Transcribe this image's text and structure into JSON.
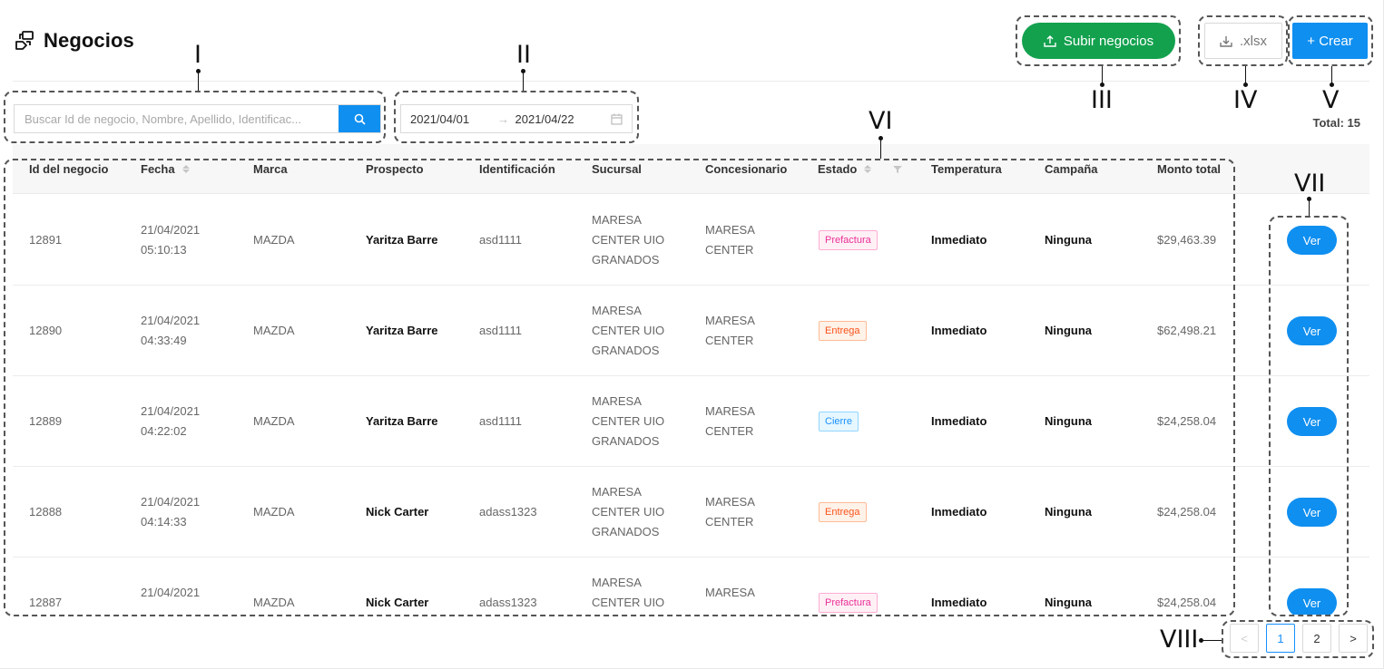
{
  "page": {
    "title": "Negocios",
    "icon": "handshake-icon"
  },
  "toolbar": {
    "upload_label": "Subir negocios",
    "xlsx_label": ".xlsx",
    "create_label": "+ Crear",
    "total_label": "Total: 15"
  },
  "search": {
    "placeholder": "Buscar Id de negocio, Nombre, Apellido, Identificac..."
  },
  "daterange": {
    "start": "2021/04/01",
    "end": "2021/04/22",
    "separator": "→"
  },
  "table": {
    "columns": [
      "Id del negocio",
      "Fecha",
      "Marca",
      "Prospecto",
      "Identificación",
      "Sucursal",
      "Concesionario",
      "Estado",
      "Temperatura",
      "Campaña",
      "Monto total"
    ],
    "action_label": "Ver",
    "rows": [
      {
        "id": "12891",
        "fecha1": "21/04/2021",
        "fecha2": "05:10:13",
        "marca": "MAZDA",
        "prospecto": "Yaritza Barre",
        "identificacion": "asd1111",
        "suc1": "MARESA",
        "suc2": "CENTER UIO",
        "suc3": "GRANADOS",
        "con1": "MARESA",
        "con2": "CENTER",
        "estado": "Prefactura",
        "estado_color": "pink",
        "temperatura": "Inmediato",
        "campana": "Ninguna",
        "monto": "$29,463.39"
      },
      {
        "id": "12890",
        "fecha1": "21/04/2021",
        "fecha2": "04:33:49",
        "marca": "MAZDA",
        "prospecto": "Yaritza Barre",
        "identificacion": "asd1111",
        "suc1": "MARESA",
        "suc2": "CENTER UIO",
        "suc3": "GRANADOS",
        "con1": "MARESA",
        "con2": "CENTER",
        "estado": "Entrega",
        "estado_color": "orange",
        "temperatura": "Inmediato",
        "campana": "Ninguna",
        "monto": "$62,498.21"
      },
      {
        "id": "12889",
        "fecha1": "21/04/2021",
        "fecha2": "04:22:02",
        "marca": "MAZDA",
        "prospecto": "Yaritza Barre",
        "identificacion": "asd1111",
        "suc1": "MARESA",
        "suc2": "CENTER UIO",
        "suc3": "GRANADOS",
        "con1": "MARESA",
        "con2": "CENTER",
        "estado": "Cierre",
        "estado_color": "blue",
        "temperatura": "Inmediato",
        "campana": "Ninguna",
        "monto": "$24,258.04"
      },
      {
        "id": "12888",
        "fecha1": "21/04/2021",
        "fecha2": "04:14:33",
        "marca": "MAZDA",
        "prospecto": "Nick Carter",
        "identificacion": "adass1323",
        "suc1": "MARESA",
        "suc2": "CENTER UIO",
        "suc3": "GRANADOS",
        "con1": "MARESA",
        "con2": "CENTER",
        "estado": "Entrega",
        "estado_color": "orange",
        "temperatura": "Inmediato",
        "campana": "Ninguna",
        "monto": "$24,258.04"
      },
      {
        "id": "12887",
        "fecha1": "21/04/2021",
        "fecha2": "",
        "marca": "MAZDA",
        "prospecto": "Nick Carter",
        "identificacion": "adass1323",
        "suc1": "MARESA",
        "suc2": "CENTER UIO",
        "suc3": "",
        "con1": "MARESA",
        "con2": "",
        "estado": "Prefactura",
        "estado_color": "pink",
        "temperatura": "Inmediato",
        "campana": "Ninguna",
        "monto": "$24,258.04"
      }
    ]
  },
  "pagination": {
    "prev": "<",
    "pages": [
      "1",
      "2"
    ],
    "active": "1",
    "next": ">"
  },
  "annotations": [
    "I",
    "II",
    "III",
    "IV",
    "V",
    "VI",
    "VII",
    "VIII"
  ],
  "colors": {
    "primary": "#0f8ff0",
    "upload_green": "#13a14e",
    "tag_pink": "#eb2f96",
    "tag_orange": "#fa541c",
    "tag_blue": "#1890ff"
  }
}
